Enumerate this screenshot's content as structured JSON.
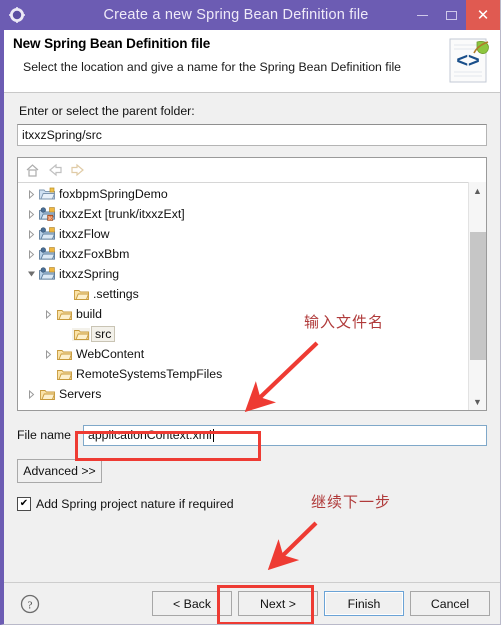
{
  "window": {
    "title": "Create a new Spring Bean Definition file",
    "gear_icon": "gear-icon",
    "minimize_label": "minimize",
    "maximize_label": "maximize",
    "close_label": "close"
  },
  "header": {
    "title": "New Spring Bean Definition file",
    "subtitle": "Select the location and give a name for the Spring Bean Definition file",
    "icon": "xml-spring-file-icon"
  },
  "parent_folder": {
    "label": "Enter or select the parent folder:",
    "value": "itxxzSpring/src",
    "placeholder": ""
  },
  "tree_toolbar": {
    "home_icon": "home-icon",
    "back_icon": "back-arrow-icon",
    "forward_icon": "forward-arrow-icon"
  },
  "tree": {
    "items": [
      {
        "label": "foxbpmSpringDemo",
        "indent": 0,
        "twisty": "collapsed",
        "icon": "project-folder-icon",
        "selected": false
      },
      {
        "label": "itxxzExt [trunk/itxxzExt]",
        "indent": 0,
        "twisty": "collapsed",
        "icon": "project-repo-icon",
        "selected": false
      },
      {
        "label": "itxxzFlow",
        "indent": 0,
        "twisty": "collapsed",
        "icon": "project-icon",
        "selected": false
      },
      {
        "label": "itxxzFoxBbm",
        "indent": 0,
        "twisty": "collapsed",
        "icon": "project-icon",
        "selected": false
      },
      {
        "label": "itxxzSpring",
        "indent": 0,
        "twisty": "expanded",
        "icon": "project-icon",
        "selected": false
      },
      {
        "label": ".settings",
        "indent": 2,
        "twisty": "none",
        "icon": "folder-icon",
        "selected": false
      },
      {
        "label": "build",
        "indent": 1,
        "twisty": "collapsed",
        "icon": "folder-icon",
        "selected": false
      },
      {
        "label": "src",
        "indent": 2,
        "twisty": "none",
        "icon": "folder-icon",
        "selected": true
      },
      {
        "label": "WebContent",
        "indent": 1,
        "twisty": "collapsed",
        "icon": "folder-icon",
        "selected": false
      },
      {
        "label": "RemoteSystemsTempFiles",
        "indent": 1,
        "twisty": "none",
        "icon": "folder-icon",
        "selected": false
      },
      {
        "label": "Servers",
        "indent": 0,
        "twisty": "collapsed",
        "icon": "folder-icon",
        "selected": false
      }
    ],
    "scrollbar": {
      "up_icon": "scroll-up-icon",
      "down_icon": "scroll-down-icon"
    }
  },
  "file_name": {
    "label": "File name",
    "value": "applicationContext.xml",
    "placeholder": ""
  },
  "advanced_button": {
    "label": "Advanced >>"
  },
  "spring_nature": {
    "label": "Add Spring project nature if required",
    "checked": true,
    "check_glyph": "✔"
  },
  "footer": {
    "help_icon": "help-icon",
    "buttons": [
      {
        "label": "< Back",
        "name": "back-button",
        "default": false
      },
      {
        "label": "Next >",
        "name": "next-button",
        "default": false
      },
      {
        "label": "Finish",
        "name": "finish-button",
        "default": true
      },
      {
        "label": "Cancel",
        "name": "cancel-button",
        "default": false
      }
    ]
  },
  "annotations": {
    "note_filename": "输入文件名",
    "note_next": "继续下一步",
    "highlight_color": "#ee3b33",
    "arrow_color": "#ee3b33",
    "text_color": "#b03a3a"
  },
  "colors": {
    "titlebar": "#6c5cb3",
    "close_button": "#e05a51",
    "dialog_background": "#f0f0f0",
    "selection": "#f3f1ea"
  }
}
